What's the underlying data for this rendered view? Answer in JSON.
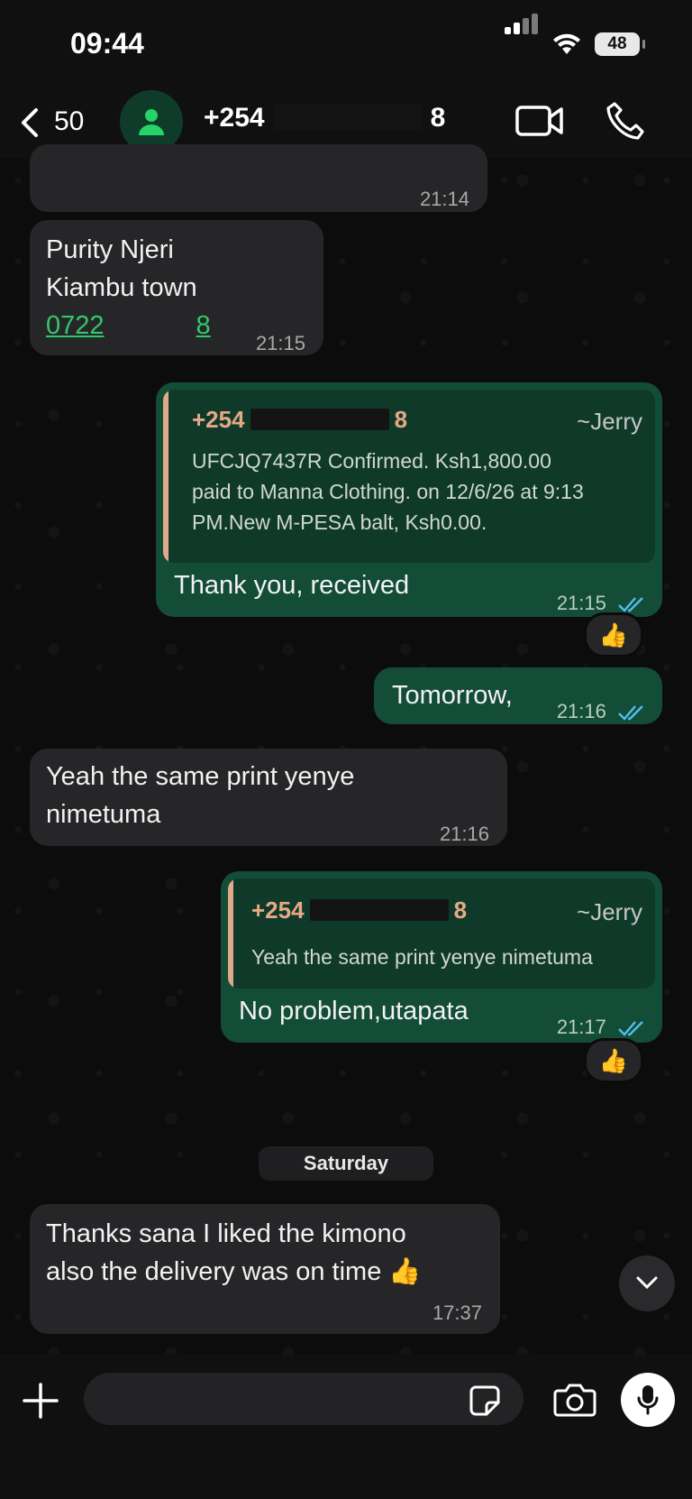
{
  "status_bar": {
    "time": "09:44",
    "battery": "48"
  },
  "header": {
    "back_count": "50",
    "contact_prefix": "+254",
    "contact_suffix": "8"
  },
  "messages": [
    {
      "id": "m0",
      "direction": "in",
      "time": "21:14"
    },
    {
      "id": "m1",
      "direction": "in",
      "lines": [
        "Purity Njeri",
        "Kiambu town"
      ],
      "link_prefix": "0722",
      "link_suffix": "8",
      "time": "21:15"
    },
    {
      "id": "m2",
      "direction": "out",
      "quote": {
        "name_prefix": "+254",
        "name_suffix": "8",
        "author": "~Jerry",
        "lines": [
          "UFCJQ7437R Confirmed. Ksh1,800.00",
          "paid to Manna Clothing. on 12/6/26 at 9:13",
          "PM.New M-PESA balt, Ksh0.00."
        ]
      },
      "text": "Thank you, received",
      "time": "21:15",
      "reaction": "👍"
    },
    {
      "id": "m3",
      "direction": "out",
      "text": "Tomorrow,",
      "time": "21:16"
    },
    {
      "id": "m4",
      "direction": "in",
      "lines": [
        "Yeah the same print yenye",
        "nimetuma"
      ],
      "time": "21:16"
    },
    {
      "id": "m5",
      "direction": "out",
      "quote": {
        "name_prefix": "+254",
        "name_suffix": "8",
        "author": "~Jerry",
        "lines": [
          "Yeah the same print yenye nimetuma"
        ]
      },
      "text": "No problem,utapata",
      "time": "21:17",
      "reaction": "👍"
    },
    {
      "id": "m6",
      "direction": "in",
      "lines": [
        "Thanks sana I liked the kimono",
        "also the delivery was on time 👍"
      ],
      "time": "17:37"
    }
  ],
  "day_separator": "Saturday",
  "composer": {
    "placeholder": ""
  },
  "colors": {
    "incoming": "#262628",
    "outgoing": "#134d37",
    "link": "#30c86a",
    "ticks": "#53bdeb",
    "quote_name": "#e7a985"
  }
}
